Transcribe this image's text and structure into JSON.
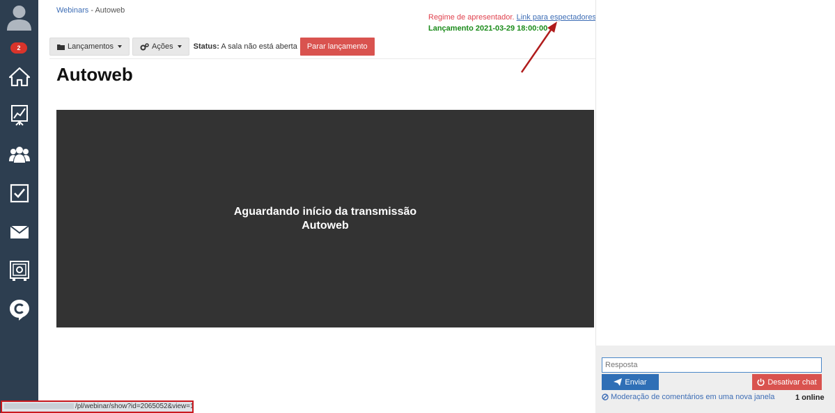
{
  "sidebar": {
    "notification_count": "2",
    "items": [
      {
        "icon": "home-icon"
      },
      {
        "icon": "chart-board-icon"
      },
      {
        "icon": "users-icon"
      },
      {
        "icon": "checkbox-icon"
      },
      {
        "icon": "envelope-icon"
      },
      {
        "icon": "safe-icon"
      },
      {
        "icon": "c-logo-icon"
      }
    ]
  },
  "breadcrumb": {
    "parent": "Webinars",
    "separator": " - ",
    "current": "Autoweb"
  },
  "presenter": {
    "mode_text": "Regime de apresentador.",
    "viewers_link": "Link para espectadores",
    "launch_text": "Lançamento 2021-03-29 18:00:00"
  },
  "toolbar": {
    "launches_label": "Lançamentos",
    "actions_label": "Ações",
    "status_label": "Status:",
    "status_value": "A sala não está aberta",
    "stop_label": "Parar lançamento"
  },
  "page_title": "Autoweb",
  "video": {
    "line1": "Aguardando início da transmissão",
    "line2": "Autoweb"
  },
  "chat": {
    "reply_placeholder": "Resposta",
    "send_label": "Enviar",
    "disable_label": "Desativar chat",
    "moderation_link": "Moderação de comentários em uma nova janela",
    "online_count": "1 online"
  },
  "statusbar": {
    "url": "/pl/webinar/show?id=2065052&view=1"
  },
  "colors": {
    "sidebar_bg": "#2d3e50",
    "accent_red": "#d9534f",
    "link_blue": "#3d6db5",
    "launch_green": "#1a8b1a",
    "video_bg": "#333333"
  }
}
